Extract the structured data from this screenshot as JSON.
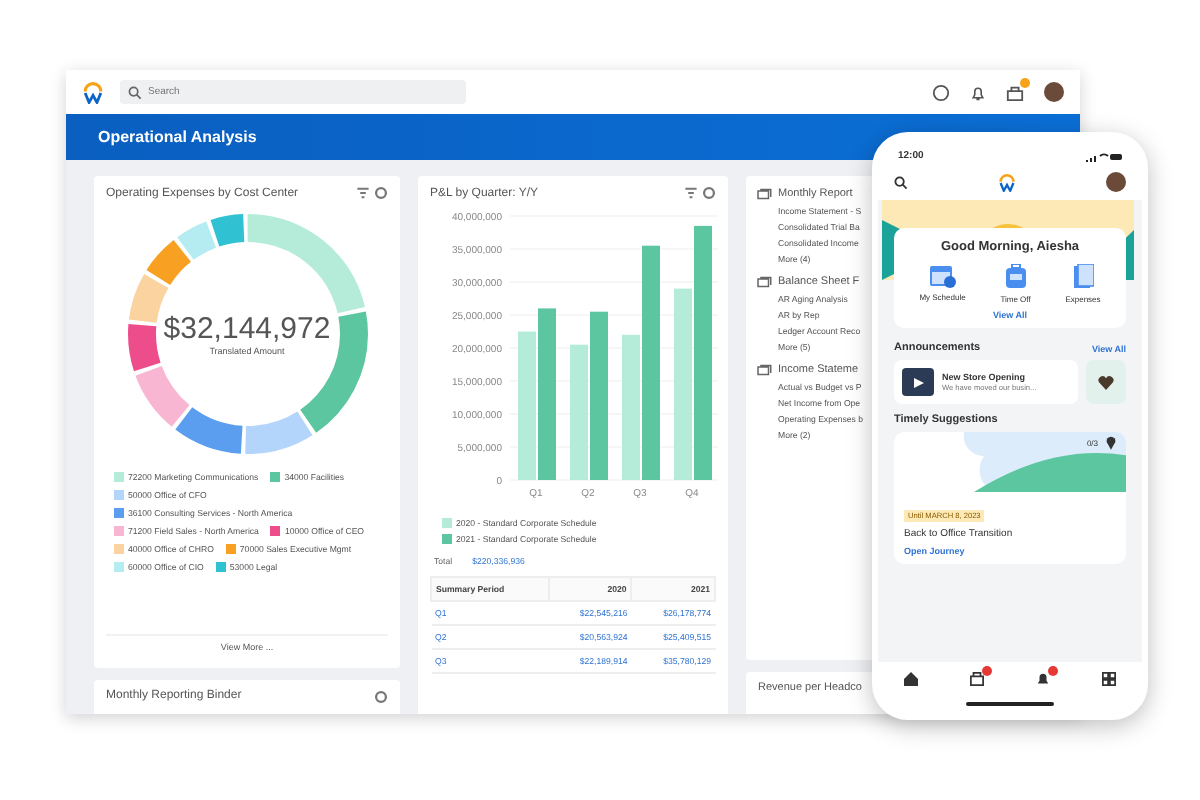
{
  "app_bar": {
    "search": {
      "placeholder": "Search"
    },
    "inbox_badge": true
  },
  "banner": {
    "title": "Operational Analysis"
  },
  "expenses_card": {
    "title": "Operating Expenses by Cost Center",
    "total": "$32,144,972",
    "total_label": "Translated Amount",
    "legend": [
      {
        "label": "72200 Marketing Communications",
        "color": "#b4ebd9"
      },
      {
        "label": "34000 Facilities",
        "color": "#5cc6a0"
      },
      {
        "label": "50000 Office of CFO",
        "color": "#b3d4fb"
      },
      {
        "label": "36100 Consulting Services - North America",
        "color": "#5b9ef0"
      },
      {
        "label": "71200 Field Sales - North America",
        "color": "#f8b6d2"
      },
      {
        "label": "10000 Office of CEO",
        "color": "#ee4d8c"
      },
      {
        "label": "40000 Office of CHRO",
        "color": "#fad3a0"
      },
      {
        "label": "70000 Sales Executive Mgmt",
        "color": "#f7a021"
      },
      {
        "label": "60000 Office of CIO",
        "color": "#b5ecf1"
      },
      {
        "label": "53000 Legal",
        "color": "#30c1d2"
      }
    ],
    "view_more": "View More ..."
  },
  "pl_card": {
    "title": "P&L by Quarter: Y/Y",
    "chart_data": {
      "type": "bar",
      "categories": [
        "Q1",
        "Q2",
        "Q3",
        "Q4"
      ],
      "series": [
        {
          "name": "2020 - Standard Corporate Schedule",
          "color": "#b4ebd9",
          "values": [
            22500000,
            20500000,
            22000000,
            29000000
          ]
        },
        {
          "name": "2021 - Standard Corporate Schedule",
          "color": "#5cc6a0",
          "values": [
            26000000,
            25500000,
            35500000,
            38500000
          ]
        }
      ],
      "grid": true,
      "ylim": [
        0,
        40000000
      ],
      "yticks": [
        {
          "value": 0,
          "label": "0"
        },
        {
          "value": 5000000,
          "label": "5,000,000"
        },
        {
          "value": 10000000,
          "label": "10,000,000"
        },
        {
          "value": 15000000,
          "label": "15,000,000"
        },
        {
          "value": 20000000,
          "label": "20,000,000"
        },
        {
          "value": 25000000,
          "label": "25,000,000"
        },
        {
          "value": 30000000,
          "label": "30,000,000"
        },
        {
          "value": 35000000,
          "label": "35,000,000"
        },
        {
          "value": 40000000,
          "label": "40,000,000"
        }
      ]
    },
    "total_label": "Total",
    "total_value": "$220,336,936",
    "table": {
      "columns": [
        "Summary Period",
        "2020",
        "2021"
      ],
      "rows": [
        [
          "Q1",
          "$22,545,216",
          "$26,178,774"
        ],
        [
          "Q2",
          "$20,563,924",
          "$25,409,515"
        ],
        [
          "Q3",
          "$22,189,914",
          "$35,780,129"
        ]
      ]
    }
  },
  "reports_card": {
    "sections": [
      {
        "title": "Monthly Report",
        "items": [
          "Income Statement - S",
          "Consolidated Trial Ba",
          "Consolidated Income"
        ],
        "more": "More (4)"
      },
      {
        "title": "Balance Sheet F",
        "items": [
          "AR Aging Analysis",
          "AR by Rep",
          "Ledger Account Reco"
        ],
        "more": "More (5)"
      },
      {
        "title": "Income Stateme",
        "items": [
          "Actual vs Budget vs P",
          "Net Income from Ope",
          "Operating Expenses b"
        ],
        "more": "More (2)"
      }
    ]
  },
  "binder_card": {
    "title": "Monthly Reporting Binder"
  },
  "revenue_card": {
    "title": "Revenue per Headco"
  },
  "phone": {
    "time": "12:00",
    "greeting": "Good Morning, Aiesha",
    "shortcuts": [
      {
        "label": "My Schedule",
        "kind": "calendar"
      },
      {
        "label": "Time Off",
        "kind": "luggage"
      },
      {
        "label": "Expenses",
        "kind": "document"
      }
    ],
    "view_all": "View All",
    "announcements": {
      "title": "Announcements",
      "view_all": "View All",
      "items": [
        {
          "title": "New Store Opening",
          "text": "We have moved our busin..."
        }
      ]
    },
    "suggestions": {
      "title": "Timely Suggestions",
      "progress": "0/3",
      "date_tag": "Until MARCH 8, 2023",
      "heading": "Back to Office Transition",
      "link": "Open Journey"
    },
    "nav": [
      {
        "kind": "home",
        "badge": false
      },
      {
        "kind": "inbox",
        "badge": true
      },
      {
        "kind": "bell",
        "badge": true
      },
      {
        "kind": "grid",
        "badge": false
      }
    ]
  }
}
